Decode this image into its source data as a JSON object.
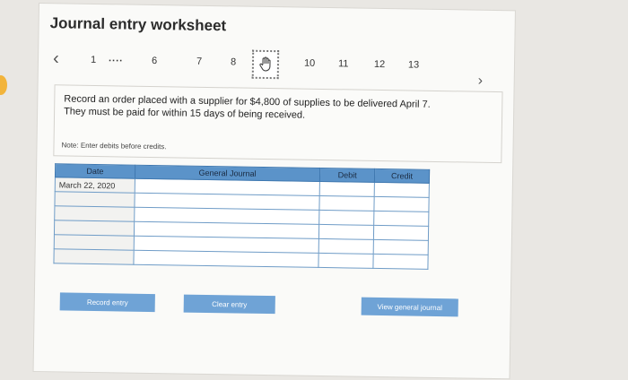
{
  "worksheet": {
    "title": "Journal entry worksheet"
  },
  "nav": {
    "prev_icon": "chevron-left-icon",
    "items": [
      "1",
      "6",
      "7",
      "8",
      "10",
      "11",
      "12",
      "13"
    ],
    "dots": "....",
    "current_icon": "hand-cursor-icon",
    "next_icon": "chevron-right-icon"
  },
  "prompt": {
    "text": "Record an order placed with a supplier for $4,800 of supplies to be delivered April 7. They must be paid for within 15 days of being received."
  },
  "note": {
    "text": "Note: Enter debits before credits."
  },
  "table": {
    "headers": {
      "date": "Date",
      "general_journal": "General Journal",
      "debit": "Debit",
      "credit": "Credit"
    },
    "rows": [
      {
        "date": "March 22, 2020",
        "account": "",
        "debit": "",
        "credit": ""
      },
      {
        "date": "",
        "account": "",
        "debit": "",
        "credit": ""
      },
      {
        "date": "",
        "account": "",
        "debit": "",
        "credit": ""
      },
      {
        "date": "",
        "account": "",
        "debit": "",
        "credit": ""
      },
      {
        "date": "",
        "account": "",
        "debit": "",
        "credit": ""
      },
      {
        "date": "",
        "account": "",
        "debit": "",
        "credit": ""
      }
    ]
  },
  "buttons": {
    "record": "Record entry",
    "clear": "Clear entry",
    "view": "View general journal"
  },
  "colors": {
    "accent": "#6fa3d6",
    "header": "#5b93c9"
  }
}
